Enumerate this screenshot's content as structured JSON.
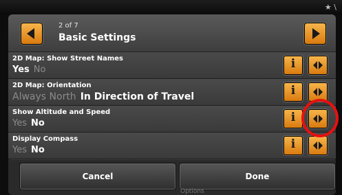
{
  "status": {
    "glyph": "★ \\"
  },
  "header": {
    "page_count": "2 of 7",
    "title": "Basic Settings"
  },
  "settings": [
    {
      "label": "2D Map: Show Street Names",
      "options": [
        "Yes",
        "No"
      ],
      "selected": "Yes"
    },
    {
      "label": "2D Map: Orientation",
      "options": [
        "Always North",
        "In Direction of Travel"
      ],
      "selected": "In Direction of Travel"
    },
    {
      "label": "Show Altitude and Speed",
      "options": [
        "Yes",
        "No"
      ],
      "selected": "No"
    },
    {
      "label": "Display Compass",
      "options": [
        "Yes",
        "No"
      ],
      "selected": "No"
    }
  ],
  "icons": {
    "prev": "arrow-left-icon",
    "next": "arrow-right-icon",
    "info": "info-icon",
    "cycle": "cycle-options-icon",
    "info_glyph": "i"
  },
  "footer": {
    "cancel_label": "Cancel",
    "done_label": "Done",
    "options_label": "Options"
  },
  "colors": {
    "button_orange": "#f0a030",
    "highlight_circle": "#e81010",
    "inactive_option": "#8b8b8b"
  }
}
